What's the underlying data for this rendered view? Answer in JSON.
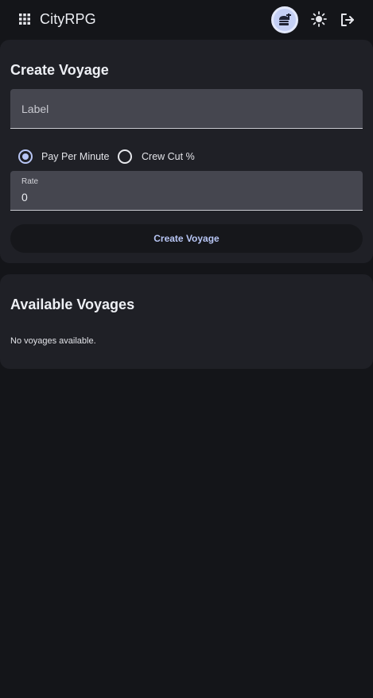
{
  "app": {
    "title": "CityRPG",
    "icons": {
      "apps": "apps-grid-icon",
      "avatar": "guild-avatar-icon",
      "theme": "sun-icon",
      "logout": "logout-icon"
    }
  },
  "create_voyage": {
    "title": "Create Voyage",
    "label_placeholder": "Label",
    "payment_options": [
      {
        "label": "Pay Per Minute",
        "selected": true
      },
      {
        "label": "Crew Cut %",
        "selected": false
      }
    ],
    "rate_label": "Rate",
    "rate_value": "0",
    "submit_label": "Create Voyage"
  },
  "available_voyages": {
    "title": "Available Voyages",
    "empty_message": "No voyages available."
  },
  "colors": {
    "background": "#141519",
    "card": "#1f2026",
    "field": "#45464f",
    "accent": "#b8c6f5"
  }
}
